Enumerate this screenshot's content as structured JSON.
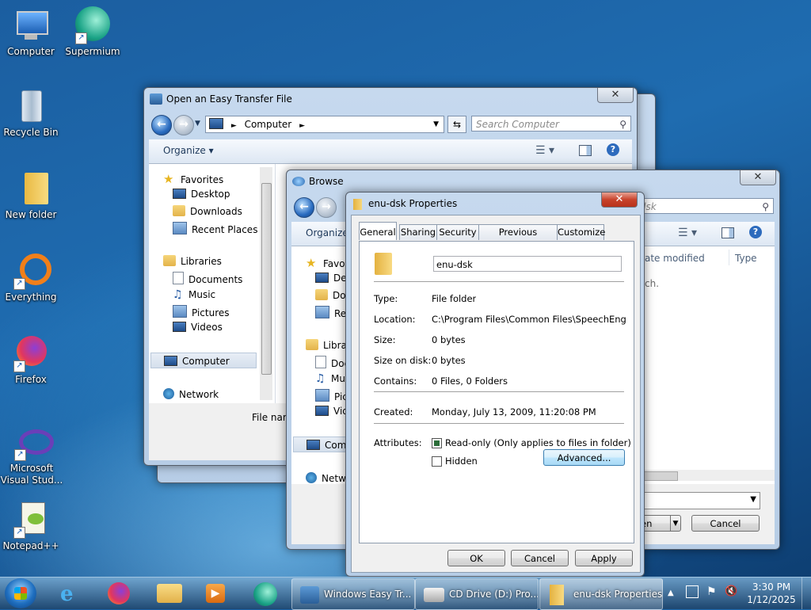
{
  "desktop": {
    "icons": [
      {
        "label": "Computer"
      },
      {
        "label": "Supermium"
      },
      {
        "label": "Recycle Bin"
      },
      {
        "label": "New folder"
      },
      {
        "label": "Everything"
      },
      {
        "label": "Firefox"
      },
      {
        "label": "Microsoft Visual Stud..."
      },
      {
        "label": "Notepad++"
      }
    ]
  },
  "open_dialog": {
    "title": "Open an Easy Transfer File",
    "address": "Computer",
    "search_placeholder": "Search Computer",
    "organize": "Organize",
    "nav": [
      "Favorites",
      "Desktop",
      "Downloads",
      "Recent Places",
      "Libraries",
      "Documents",
      "Music",
      "Pictures",
      "Videos",
      "Computer",
      "Network"
    ],
    "filename_label": "File nam"
  },
  "browse_dialog": {
    "title": "Browse",
    "search_placeholder": "enu-dsk",
    "organize": "Organize",
    "nav": [
      "Favo",
      "Des",
      "Dov",
      "Rec",
      "Libra",
      "Doc",
      "Mu",
      "Pic",
      "Vid",
      "Com",
      "Netw"
    ],
    "columns": {
      "date_modified": "ate modified",
      "type": "Type"
    },
    "empty_text": "ch.",
    "open_label": "en",
    "cancel": "Cancel"
  },
  "properties": {
    "title": "enu-dsk Properties",
    "tabs": [
      "General",
      "Sharing",
      "Security",
      "Previous Versions",
      "Customize"
    ],
    "name": "enu-dsk",
    "fields": {
      "type_label": "Type:",
      "type": "File folder",
      "location_label": "Location:",
      "location": "C:\\Program Files\\Common Files\\SpeechEngines\\Mic",
      "size_label": "Size:",
      "size": "0 bytes",
      "size_on_disk_label": "Size on disk:",
      "size_on_disk": "0 bytes",
      "contains_label": "Contains:",
      "contains": "0 Files, 0 Folders",
      "created_label": "Created:",
      "created": "Monday, July 13, 2009, 11:20:08 PM",
      "attributes_label": "Attributes:"
    },
    "readonly_label": "Read-only (Only applies to files in folder)",
    "hidden_label": "Hidden",
    "advanced": "Advanced...",
    "ok": "OK",
    "cancel": "Cancel",
    "apply": "Apply"
  },
  "taskbar": {
    "tasks": [
      "Windows Easy Tr...",
      "CD Drive (D:) Pro...",
      "enu-dsk Properties"
    ],
    "time": "3:30 PM",
    "date": "1/12/2025"
  }
}
